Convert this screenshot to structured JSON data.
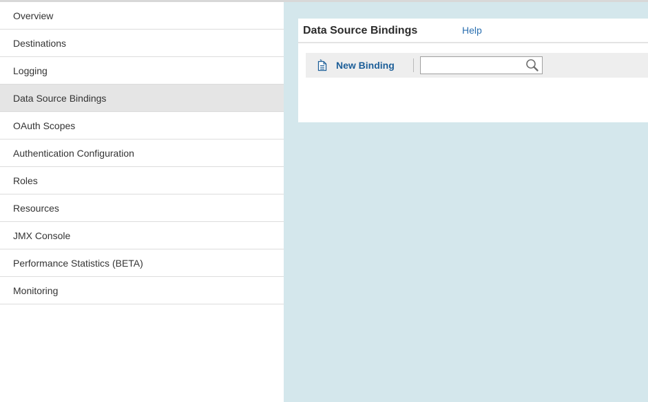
{
  "sidebar": {
    "items": [
      {
        "label": "Overview"
      },
      {
        "label": "Destinations"
      },
      {
        "label": "Logging"
      },
      {
        "label": "Data Source Bindings",
        "active": true
      },
      {
        "label": "OAuth Scopes"
      },
      {
        "label": "Authentication Configuration"
      },
      {
        "label": "Roles"
      },
      {
        "label": "Resources"
      },
      {
        "label": "JMX Console"
      },
      {
        "label": "Performance Statistics (BETA)"
      },
      {
        "label": "Monitoring"
      }
    ]
  },
  "panel": {
    "title": "Data Source Bindings",
    "help_label": "Help"
  },
  "toolbar": {
    "new_binding_label": "New Binding",
    "new_binding_icon": "new-document-icon",
    "search_value": "",
    "search_placeholder": "",
    "search_icon": "search-icon"
  },
  "colors": {
    "main_background": "#d4e7ec",
    "active_nav_background": "#e5e5e5",
    "link_color": "#2a6fb0",
    "action_color": "#1c5e98"
  }
}
